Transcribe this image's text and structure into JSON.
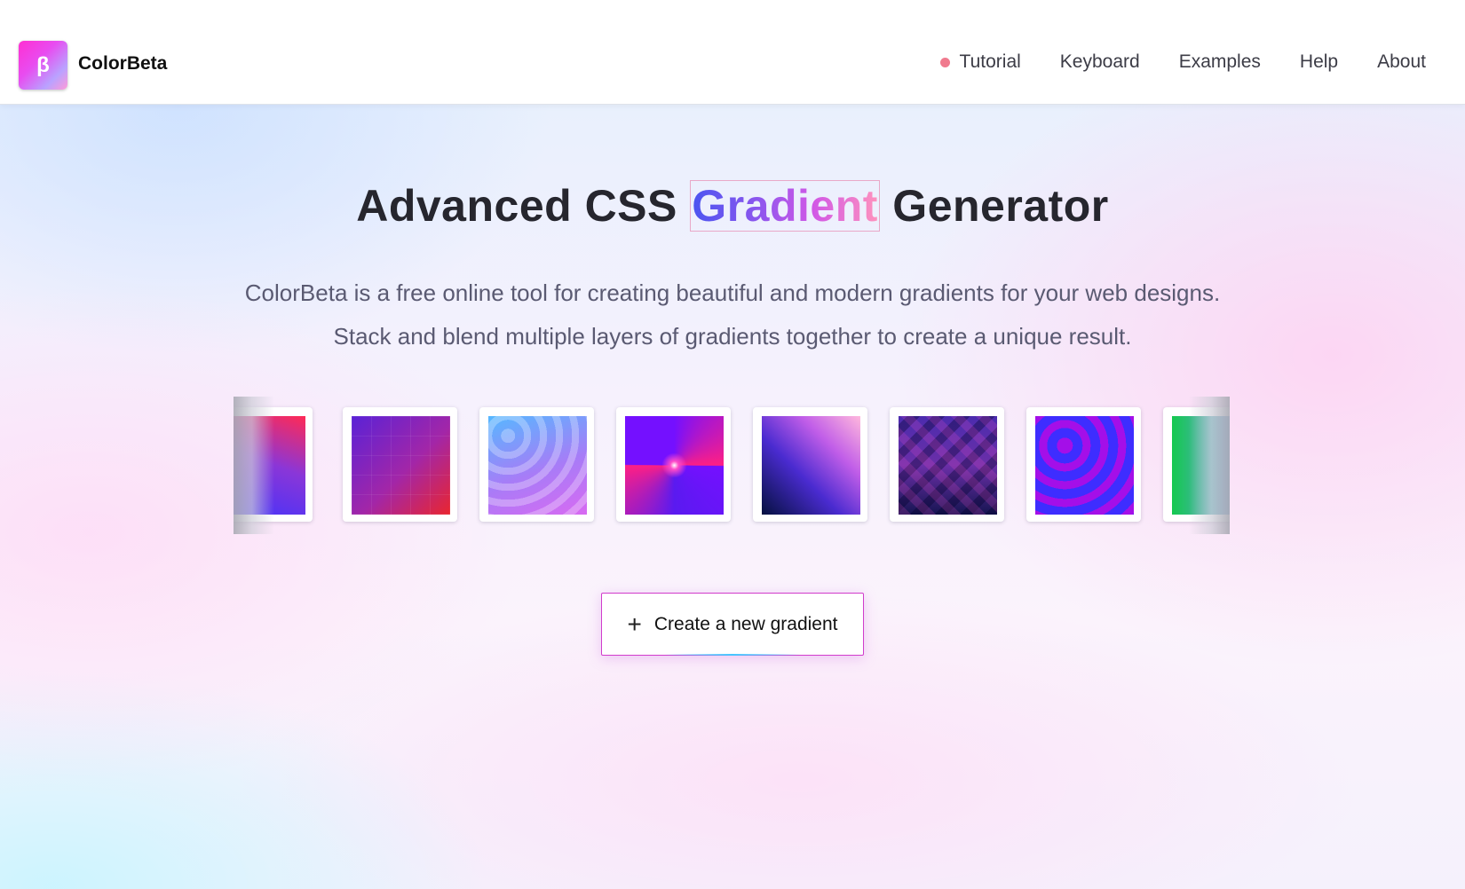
{
  "brand": {
    "logo_glyph": "β",
    "name": "ColorBeta"
  },
  "nav": {
    "items": [
      {
        "label": "Tutorial",
        "dot_color": "#f07a8e"
      },
      {
        "label": "Keyboard"
      },
      {
        "label": "Examples"
      },
      {
        "label": "Help"
      },
      {
        "label": "About"
      }
    ]
  },
  "hero": {
    "title_before": "Advanced CSS",
    "title_highlight": "Gradient",
    "title_after": "Generator",
    "subtitle_line1": "ColorBeta is a free online tool for creating beautiful and modern gradients for your web designs.",
    "subtitle_line2": "Stack and blend multiple layers of gradients together to create a unique result."
  },
  "gallery": {
    "items": [
      {
        "name": "red-blue-gradient"
      },
      {
        "name": "purple-red-grid-gradient"
      },
      {
        "name": "blue-wave-gradient"
      },
      {
        "name": "violet-pink-conic-gradient"
      },
      {
        "name": "navy-pink-gradient"
      },
      {
        "name": "dark-diamond-gradient"
      },
      {
        "name": "blue-magenta-wave-gradient"
      },
      {
        "name": "green-blue-gradient"
      }
    ]
  },
  "cta": {
    "icon": "plus-icon",
    "label": "Create a new gradient"
  },
  "colors": {
    "accent_border": "#d13ccc",
    "heading": "#26262e",
    "subtitle": "#5a5a72"
  }
}
